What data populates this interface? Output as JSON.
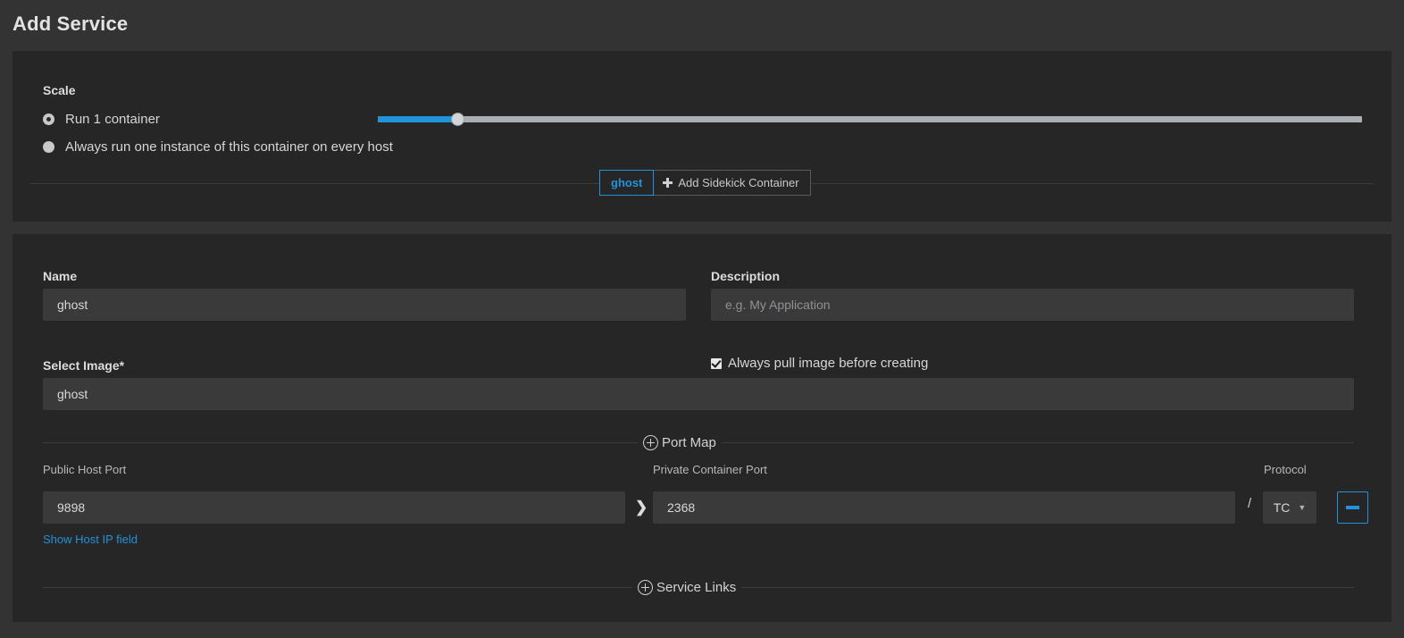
{
  "header": {
    "title": "Add Service"
  },
  "scale": {
    "section_label": "Scale",
    "options": [
      {
        "label": "Run 1 container",
        "selected": true
      },
      {
        "label": "Always run one instance of this container on every host",
        "selected": false
      }
    ],
    "slider": {
      "value_percent": 8.5,
      "fill_color": "#2193da",
      "track_color": "#a8aeb2"
    }
  },
  "sidekick": {
    "tabs": [
      {
        "label": "ghost",
        "active": true
      },
      {
        "label": "Add Sidekick Container",
        "active": false,
        "icon": "plus-icon"
      }
    ]
  },
  "form": {
    "name": {
      "label": "Name",
      "value": "ghost",
      "placeholder": ""
    },
    "description": {
      "label": "Description",
      "value": "",
      "placeholder": "e.g. My Application"
    },
    "select_image": {
      "label": "Select Image*",
      "value": "ghost",
      "placeholder": ""
    },
    "always_pull": {
      "label": "Always pull image before creating",
      "checked": true
    }
  },
  "port_map": {
    "section_label": "Port Map",
    "public_host_port_label": "Public Host Port",
    "private_container_port_label": "Private Container Port",
    "protocol_label": "Protocol",
    "separator_chevron": "❯",
    "separator_slash": "/",
    "rows": [
      {
        "public_host_port": "9898",
        "private_container_port": "2368",
        "protocol": "TC",
        "remove_label": "remove-icon"
      }
    ],
    "show_host_ip_link": "Show Host IP field"
  },
  "service_links": {
    "section_label": "Service Links"
  },
  "colors": {
    "page_background": "#333333",
    "panel_background": "#262626",
    "input_background": "#3a3a3a",
    "accent_blue": "#2193da",
    "text_primary": "#d8d8d8",
    "text_muted": "#b7b7b7"
  }
}
